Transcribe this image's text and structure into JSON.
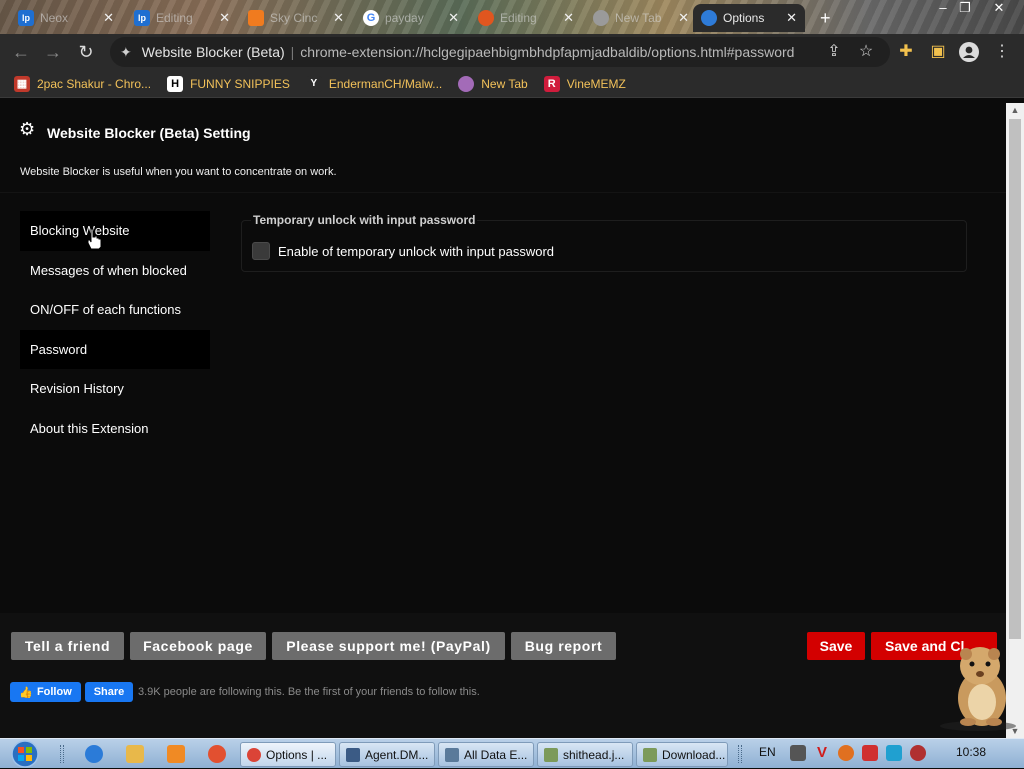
{
  "tabs": [
    {
      "label": "Neox",
      "icon": "lp-icon",
      "active": false
    },
    {
      "label": "Editing",
      "icon": "lp-icon",
      "active": false
    },
    {
      "label": "Sky Cinc",
      "icon": "orange-tab-icon",
      "active": false
    },
    {
      "label": "payday",
      "icon": "google-icon",
      "active": false
    },
    {
      "label": "Editing",
      "icon": "orange-tab-icon",
      "active": false
    },
    {
      "label": "New Tab",
      "icon": "chrome-icon",
      "active": false
    },
    {
      "label": "Options",
      "icon": "blocker-icon",
      "active": true
    }
  ],
  "toolbar": {
    "site_name": "Website Blocker (Beta)",
    "url": "chrome-extension://hclgegipaehbigmbhdpfapmjadbaldib/options.html#password"
  },
  "bookmarks": [
    {
      "label": "2pac Shakur - Chro...",
      "icon": "bookmark-icon"
    },
    {
      "label": "FUNNY SNIPPIES",
      "icon": "h-icon"
    },
    {
      "label": "EndermanCH/Malw...",
      "icon": "yp-icon"
    },
    {
      "label": "New Tab",
      "icon": "globe-icon"
    },
    {
      "label": "VineMEMZ",
      "icon": "r-icon"
    }
  ],
  "header": {
    "title": "Website Blocker (Beta) Setting",
    "subtitle": "Website Blocker is useful when you want to concentrate on work."
  },
  "sidebar": {
    "items": [
      {
        "label": "Blocking Website"
      },
      {
        "label": "Messages of when blocked"
      },
      {
        "label": "ON/OFF of each functions"
      },
      {
        "label": "Password"
      },
      {
        "label": "Revision History"
      },
      {
        "label": "About this Extension"
      }
    ]
  },
  "main": {
    "section_title": "Temporary unlock with input password",
    "checkbox_label": "Enable of temporary unlock with input password",
    "checkbox_checked": false
  },
  "footer": {
    "buttons": [
      "Tell a friend",
      "Facebook page",
      "Please support me! (PayPal)",
      "Bug report"
    ],
    "save": "Save",
    "save_close": "Save and Cl",
    "fb_follow": "Follow",
    "fb_share": "Share",
    "fb_text": "3.9K people are following this. Be the first of your friends to follow this."
  },
  "taskbar": {
    "tasks": [
      "Options | ...",
      "Agent.DM...",
      "All Data E...",
      "shithead.j...",
      "Download..."
    ],
    "lang": "EN",
    "clock": "10:38"
  },
  "colors": {
    "accent_red": "#d30000",
    "facebook_blue": "#1877f2",
    "bookmark_text": "#f3c25a"
  }
}
